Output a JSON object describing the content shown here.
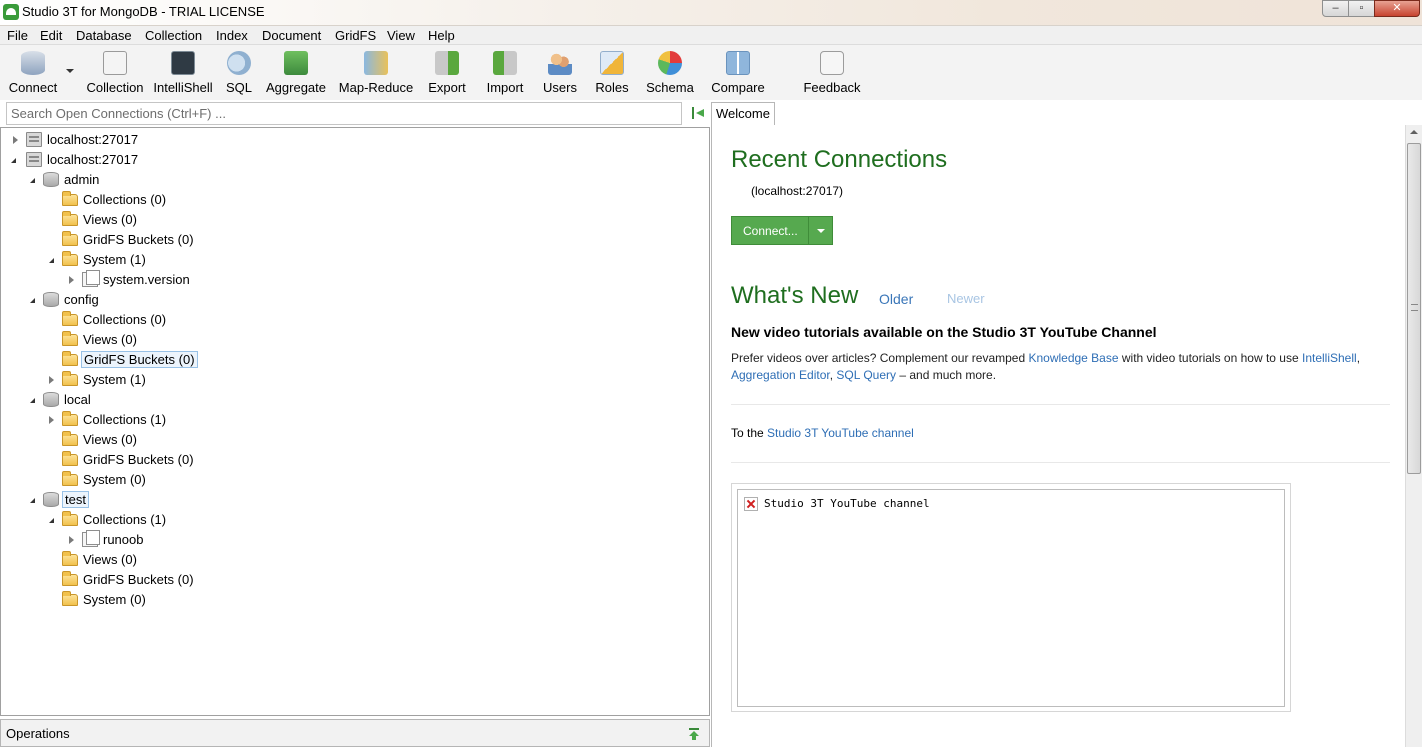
{
  "window": {
    "title": "Studio 3T for MongoDB - TRIAL LICENSE",
    "close": "✕",
    "minimize": "‒",
    "maximize": "▫"
  },
  "menu": [
    "File",
    "Edit",
    "Database",
    "Collection",
    "Index",
    "Document",
    "GridFS",
    "View",
    "Help"
  ],
  "toolbar": {
    "connect": "Connect",
    "collection": "Collection",
    "intellishell": "IntelliShell",
    "sql": "SQL",
    "aggregate": "Aggregate",
    "map_reduce": "Map-Reduce",
    "export": "Export",
    "import": "Import",
    "users": "Users",
    "roles": "Roles",
    "schema": "Schema",
    "compare": "Compare",
    "feedback": "Feedback"
  },
  "search": {
    "placeholder": "Search Open Connections (Ctrl+F) ..."
  },
  "tabs": {
    "welcome": "Welcome"
  },
  "tree": [
    {
      "label": "localhost:27017"
    },
    {
      "label": "localhost:27017"
    },
    {
      "label": "admin"
    },
    {
      "label": "Collections (0)"
    },
    {
      "label": "Views (0)"
    },
    {
      "label": "GridFS Buckets (0)"
    },
    {
      "label": "System (1)"
    },
    {
      "label": "system.version"
    },
    {
      "label": "config"
    },
    {
      "label": "Collections (0)"
    },
    {
      "label": "Views (0)"
    },
    {
      "label": "GridFS Buckets (0)"
    },
    {
      "label": "System (1)"
    },
    {
      "label": "local"
    },
    {
      "label": "Collections (1)"
    },
    {
      "label": "Views (0)"
    },
    {
      "label": "GridFS Buckets (0)"
    },
    {
      "label": "System (0)"
    },
    {
      "label": "test"
    },
    {
      "label": "Collections (1)"
    },
    {
      "label": "runoob"
    },
    {
      "label": "Views (0)"
    },
    {
      "label": "GridFS Buckets (0)"
    },
    {
      "label": "System (0)"
    }
  ],
  "operations": {
    "label": "Operations"
  },
  "welcome": {
    "recent_title": "Recent Connections",
    "recent_item": "(localhost:27017)",
    "connect_button": "Connect...",
    "whats_new_title": "What's New",
    "older": "Older",
    "newer": "Newer",
    "news_heading": "New video tutorials available on the Studio 3T YouTube Channel",
    "news_p1": "Prefer videos over articles? Complement our revamped ",
    "news_link_kb": "Knowledge Base",
    "news_p2": " with video tutorials on how to use ",
    "news_link_intellishell": "IntelliShell",
    "news_p3": ",",
    "news_link_agg": "Aggregation Editor",
    "news_p4": ", ",
    "news_link_sql": "SQL Query",
    "news_p5": " – and much more.",
    "yt_prefix": "To the ",
    "yt_link": "Studio 3T YouTube channel",
    "embed_alt": "Studio 3T YouTube channel"
  },
  "colors": {
    "heading_green": "#1f6e1f",
    "connect_green": "#56a94f",
    "link_blue": "#2e6eb5"
  }
}
